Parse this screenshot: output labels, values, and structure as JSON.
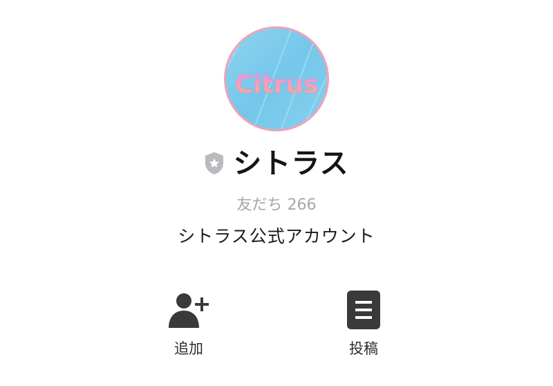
{
  "profile": {
    "avatar_text": "Citrus",
    "name": "シトラス",
    "friends_text": "友だち 266",
    "description": "シトラス公式アカウント"
  },
  "actions": [
    {
      "label": "追加",
      "icon": "add-friend-icon"
    },
    {
      "label": "投稿",
      "icon": "posts-icon"
    }
  ],
  "colors": {
    "avatar_bg": "#7ccbeb",
    "avatar_border": "#f0a2b9",
    "logo_gradient_start": "#ee8ef0",
    "logo_gradient_end": "#f7b47a",
    "badge": "#b8babd",
    "icon": "#3a3a3a",
    "friends_text": "#a7a7a7"
  }
}
